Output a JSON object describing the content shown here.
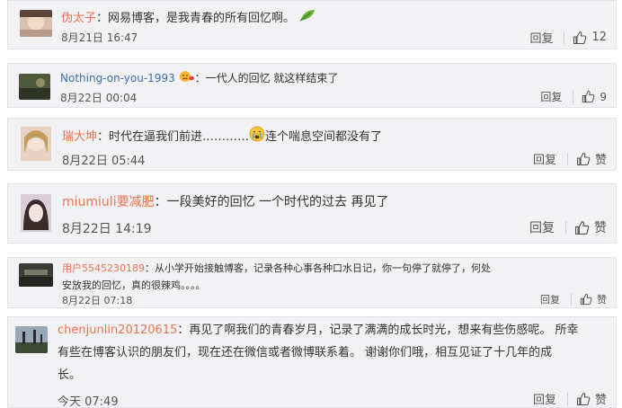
{
  "comments": [
    {
      "user": "伪太子",
      "colon": "：",
      "text": "网易博客，是我青春的所有回忆啊。",
      "emoji": "leaf-emoji",
      "time": "8月21日 16:47",
      "reply": "回复",
      "likes": "12"
    },
    {
      "user": "Nothing-on-you-1993",
      "colon": "：",
      "text": "一代人的回忆 就这样结束了",
      "emoji": "sad-face-emoji",
      "time": "8月22日 00:04",
      "reply": "回复",
      "likes": "9"
    },
    {
      "user": "瑞大坤",
      "colon": "：",
      "text_before": "时代在逼我们前进…………",
      "emoji": "crying-face-emoji",
      "text_after": "连个喘息空间都没有了",
      "time": "8月22日 05:44",
      "reply": "回复",
      "likes": "赞"
    },
    {
      "user": "miumiuli要减肥",
      "colon": "：",
      "text": "一段美好的回忆 一个时代的过去 再见了",
      "time": "8月22日 14:19",
      "reply": "回复",
      "likes": "赞"
    },
    {
      "user": "用户5545230189",
      "colon": "：",
      "text_line1": "从小学开始接触博客，记录各种心事各种口水日记，你一句停了就停了，何处",
      "text_line2": "安放我的回忆，真的很辣鸡。。。。",
      "time": "8月22日 07:18",
      "reply": "回复",
      "likes": "赞"
    },
    {
      "user": "chenjunlin20120615",
      "colon": "：",
      "text_line1": "再见了啊我们的青春岁月，记录了满满的成长时光，想来有些伤感呢。 所幸",
      "text_line2": "有些在博客认识的朋友们，现在还在微信或者微博联系着。 谢谢你们哦，相互见证了十几年的成",
      "text_line3": "长。",
      "time": "今天 07:49",
      "reply": "回复",
      "likes": "赞"
    }
  ]
}
